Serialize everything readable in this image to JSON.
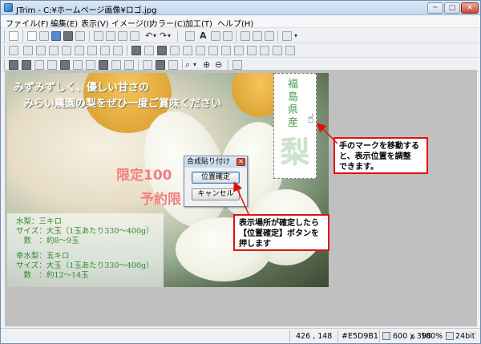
{
  "window": {
    "title": "JTrim - C:¥ホームページ画像¥ロゴ.jpg",
    "buttons": {
      "minimize": "─",
      "maximize": "□",
      "close": "✕"
    }
  },
  "menu": [
    {
      "label": "ファイル(F)"
    },
    {
      "label": "編集(E)"
    },
    {
      "label": "表示(V)"
    },
    {
      "label": "イメージ(I)"
    },
    {
      "label": "カラー(C)"
    },
    {
      "label": "加工(T)"
    },
    {
      "label": "ヘルプ(H)"
    }
  ],
  "toolbar_glyphs": {
    "undo": "↶",
    "redo": "↷",
    "text_a": "A",
    "zoom_in": "⊕",
    "zoom_out": "⊖",
    "zoom_dd": "⌕",
    "dropdown": "▾"
  },
  "canvas": {
    "heading_line1": "みずみずしく、優しい甘さの",
    "heading_line2": "みらい農園の梨をぜひ一度ご賞味ください",
    "promo_line1": "限定100",
    "promo_line2": "予約限",
    "info_lines": [
      "水梨：三キロ",
      "サイズ：大玉（1玉あたり330～400g）",
      "　数　：約8～9玉",
      "幸水梨：五キロ",
      "サイズ：大玉（1玉あたり330～400g）",
      "　数　：約12～14玉"
    ]
  },
  "logo": {
    "chars": [
      "福",
      "島",
      "県",
      "産"
    ],
    "big_char": "梨"
  },
  "dialog": {
    "title": "合成貼り付け",
    "close": "✕",
    "confirm_label": "位置確定",
    "cancel_label": "キャンセル"
  },
  "callouts": {
    "move_hint": [
      "手のマークを移動する",
      "と、表示位置を調整",
      "できます。"
    ],
    "confirm_hint": [
      "表示場所が確定したら",
      "【位置確定】ボタンを",
      "押します"
    ]
  },
  "cursor": {
    "glyph": "☝"
  },
  "status": {
    "coords": "426 , 148",
    "color": "#E5D9B1",
    "size": "600 x 398",
    "zoom": "100%",
    "depth": "24bit",
    "grip": "⋰"
  },
  "colors": {
    "accent_red": "#e01010",
    "title_bar": "#c2d6ec",
    "promo_pink": "#f08080",
    "info_green": "#2e8b2e"
  }
}
